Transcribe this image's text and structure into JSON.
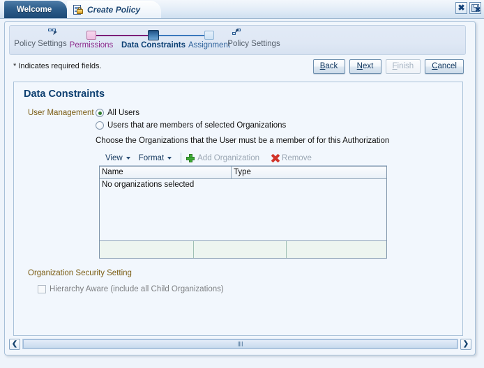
{
  "window": {
    "close_button": "close-window",
    "save_close_button": "save-and-close"
  },
  "tabs": [
    {
      "label": "Welcome",
      "active": false,
      "icon": ""
    },
    {
      "label": "Create Policy",
      "active": true,
      "icon": "policy-document-lock-icon"
    }
  ],
  "train": {
    "steps": [
      {
        "label": "Policy Settings",
        "state": "plain",
        "icon": "select-pointer-icon"
      },
      {
        "label": "Permissions",
        "state": "visited"
      },
      {
        "label": "Data Constraints",
        "state": "current"
      },
      {
        "label": "Assignment",
        "state": "future"
      },
      {
        "label": "Policy Settings",
        "state": "plain",
        "icon": "assignment-pointer-icon"
      }
    ]
  },
  "required_note": "* Indicates required fields.",
  "buttons": {
    "back": {
      "label": "Back",
      "mnemonic": "B",
      "disabled": false
    },
    "next": {
      "label": "Next",
      "mnemonic": "N",
      "disabled": false
    },
    "finish": {
      "label": "Finish",
      "mnemonic": "F",
      "disabled": true
    },
    "cancel": {
      "label": "Cancel",
      "mnemonic": "C",
      "disabled": false
    }
  },
  "page": {
    "title": "Data Constraints",
    "user_management_label": "User Management",
    "radios": [
      {
        "label": "All Users",
        "selected": true
      },
      {
        "label": "Users that are members of selected Organizations",
        "selected": false
      }
    ],
    "choose_text": "Choose the Organizations that the User must be a member of for this Authorization",
    "table": {
      "toolbar": {
        "view": "View",
        "format": "Format",
        "add": "Add Organization",
        "remove": "Remove",
        "add_disabled": true,
        "remove_disabled": true
      },
      "columns": [
        "Name",
        "Type"
      ],
      "rows": [],
      "empty_message": "No organizations selected"
    },
    "org_security_label": "Organization Security Setting",
    "hierarchy_checkbox": {
      "label": "Hierarchy Aware (include all Child Organizations)",
      "checked": false,
      "disabled": true
    }
  },
  "scrollbar": {
    "left_arrow": "❮",
    "right_arrow": "❯"
  },
  "colors": {
    "accent_blue": "#0d3f70",
    "label_olive": "#7a5c12",
    "visited_link": "#8c2a8c",
    "add_icon_green": "#3fae36",
    "remove_icon_red": "#d1342a",
    "panel_bg": "#f1f6fc"
  }
}
